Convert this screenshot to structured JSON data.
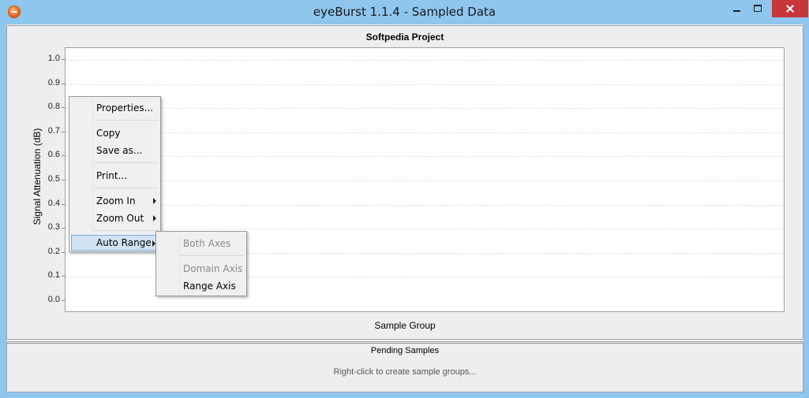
{
  "window": {
    "title": "eyeBurst 1.1.4 - Sampled Data",
    "icon": "eyeburst-app-icon"
  },
  "chart": {
    "title": "Softpedia Project",
    "ylabel": "Signal Attenuation (dB)",
    "xlabel": "Sample Group",
    "y_ticks": [
      "1.0",
      "0.9",
      "0.8",
      "0.7",
      "0.6",
      "0.5",
      "0.4",
      "0.3",
      "0.2",
      "0.1",
      "0.0"
    ]
  },
  "chart_data": {
    "type": "bar",
    "title": "Softpedia Project",
    "xlabel": "Sample Group",
    "ylabel": "Signal Attenuation (dB)",
    "categories": [],
    "values": [],
    "ylim": [
      0.0,
      1.0
    ],
    "y_ticks": [
      0.0,
      0.1,
      0.2,
      0.3,
      0.4,
      0.5,
      0.6,
      0.7,
      0.8,
      0.9,
      1.0
    ],
    "grid": true
  },
  "context_menu": {
    "properties": "Properties...",
    "copy": "Copy",
    "save_as": "Save as...",
    "print": "Print...",
    "zoom_in": "Zoom In",
    "zoom_out": "Zoom Out",
    "auto_range": "Auto Range"
  },
  "submenu": {
    "both_axes": "Both Axes",
    "domain_axis": "Domain Axis",
    "range_axis": "Range Axis"
  },
  "status": {
    "title": "Pending Samples",
    "hint": "Right-click to create sample groups..."
  }
}
